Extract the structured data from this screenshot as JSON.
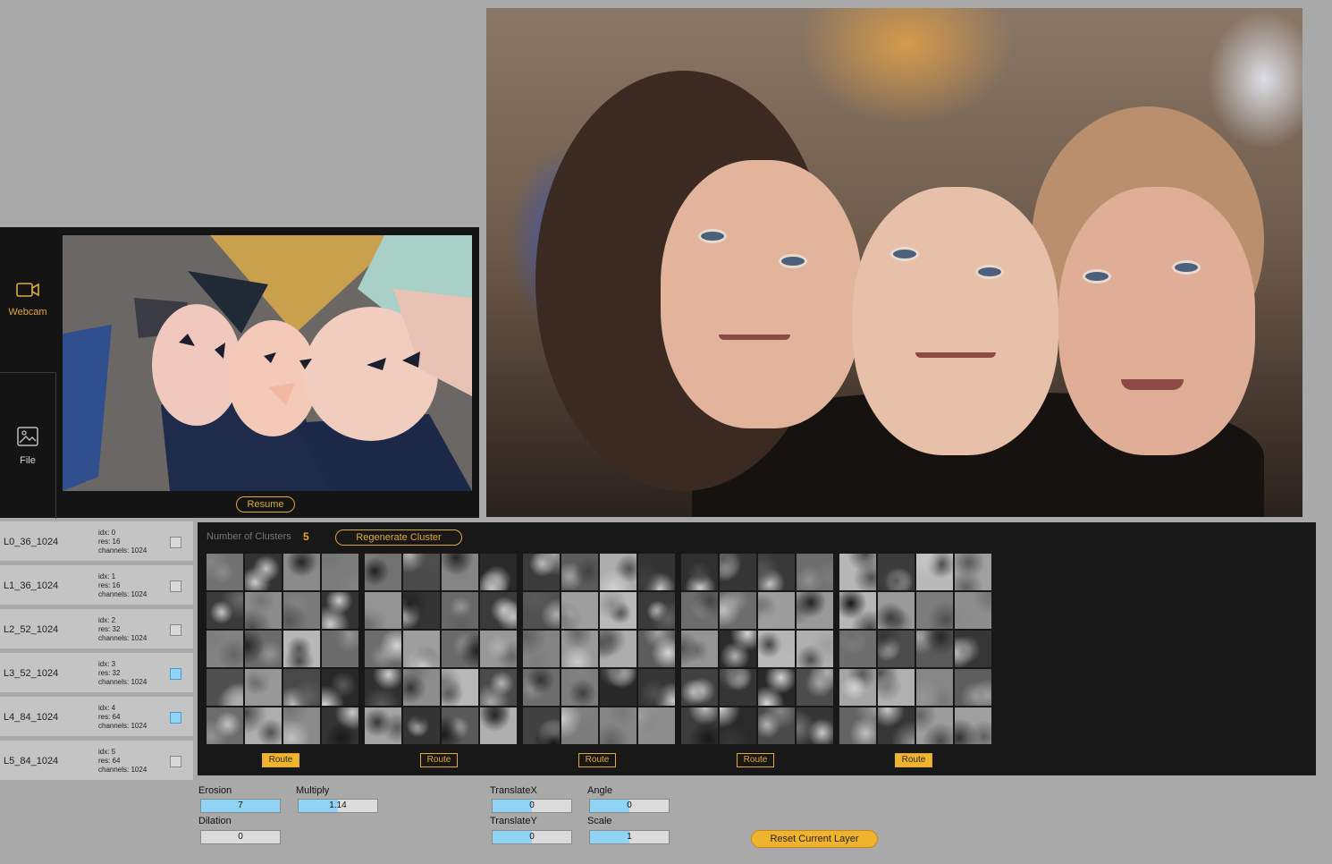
{
  "source": {
    "tabs": [
      {
        "label": "Webcam",
        "icon": "video-camera-icon",
        "active": true
      },
      {
        "label": "File",
        "icon": "image-icon",
        "active": false
      }
    ],
    "resume_label": "Resume"
  },
  "layers": [
    {
      "name": "L0_36_1024",
      "info": [
        "idx: 0",
        "res: 16",
        "channels: 1024"
      ],
      "checked": false
    },
    {
      "name": "L1_36_1024",
      "info": [
        "idx: 1",
        "res: 16",
        "channels: 1024"
      ],
      "checked": false
    },
    {
      "name": "L2_52_1024",
      "info": [
        "idx: 2",
        "res: 32",
        "channels: 1024"
      ],
      "checked": false
    },
    {
      "name": "L3_52_1024",
      "info": [
        "idx: 3",
        "res: 32",
        "channels: 1024"
      ],
      "checked": true
    },
    {
      "name": "L4_84_1024",
      "info": [
        "idx: 4",
        "res: 64",
        "channels: 1024"
      ],
      "checked": true
    },
    {
      "name": "L5_84_1024",
      "info": [
        "idx: 5",
        "res: 64",
        "channels: 1024"
      ],
      "checked": false
    }
  ],
  "clusters": {
    "label": "Number of Clusters",
    "count": "5",
    "regenerate_label": "Regenerate Cluster",
    "route_label": "Route",
    "route_filled": [
      true,
      false,
      false,
      false,
      true
    ]
  },
  "controls": {
    "erosion": {
      "label": "Erosion",
      "value": "7"
    },
    "dilation": {
      "label": "Dilation",
      "value": "0"
    },
    "multiply": {
      "label": "Multiply",
      "value": "1.14"
    },
    "translate_x": {
      "label": "TranslateX",
      "value": "0"
    },
    "translate_y": {
      "label": "TranslateY",
      "value": "0"
    },
    "angle": {
      "label": "Angle",
      "value": "0"
    },
    "scale": {
      "label": "Scale",
      "value": "1"
    },
    "reset_label": "Reset Current Layer"
  },
  "colors": {
    "accent": "#e0a93b",
    "panel": "#181818",
    "background": "#a9a9a9",
    "checkbox_active": "#8fd3f5"
  }
}
